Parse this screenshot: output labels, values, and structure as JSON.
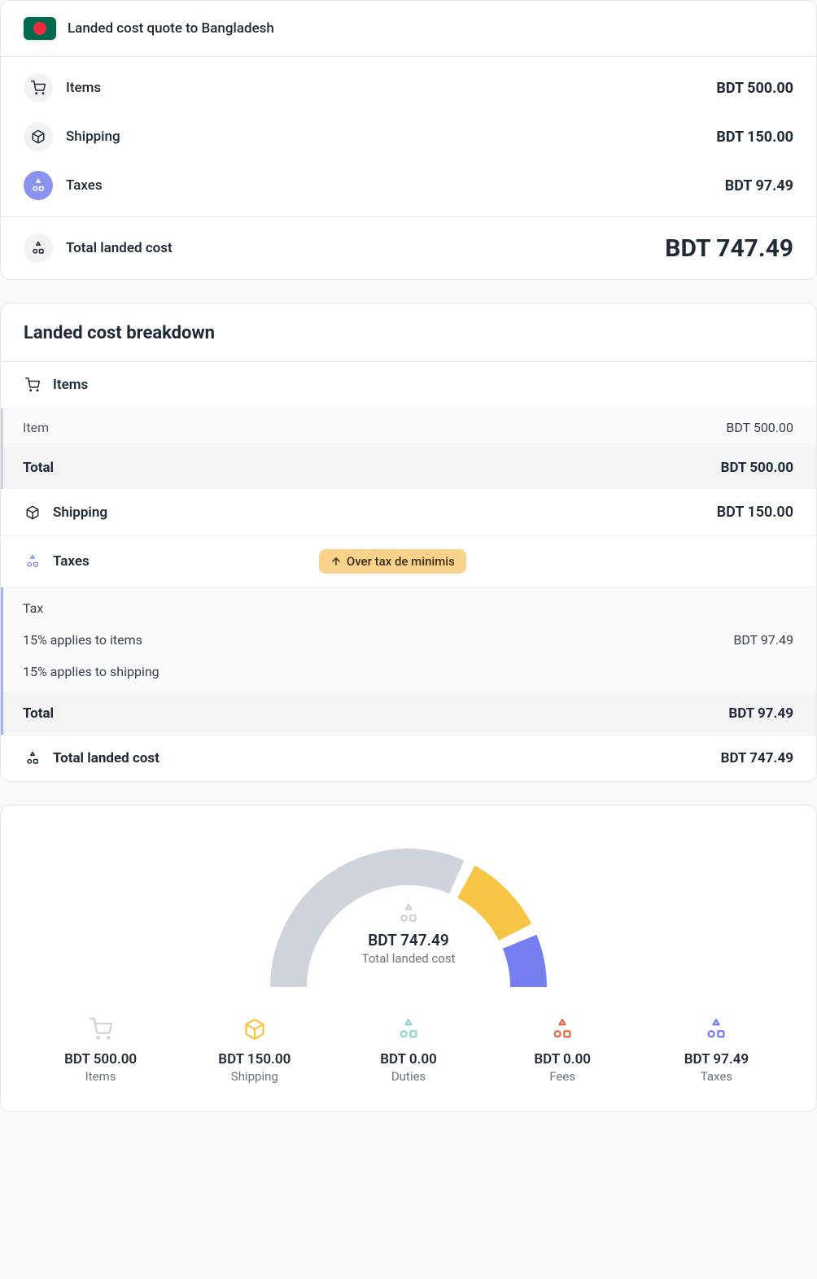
{
  "header": {
    "title": "Landed cost quote to Bangladesh"
  },
  "summary": {
    "items": {
      "label": "Items",
      "value": "BDT 500.00"
    },
    "shipping": {
      "label": "Shipping",
      "value": "BDT 150.00"
    },
    "taxes": {
      "label": "Taxes",
      "value": "BDT 97.49"
    },
    "total": {
      "label": "Total landed cost",
      "value": "BDT 747.49"
    }
  },
  "breakdown": {
    "title": "Landed cost breakdown",
    "items_header": "Items",
    "item_row": {
      "label": "Item",
      "value": "BDT 500.00"
    },
    "items_total": {
      "label": "Total",
      "value": "BDT 500.00"
    },
    "shipping": {
      "label": "Shipping",
      "value": "BDT 150.00"
    },
    "taxes_header": "Taxes",
    "taxes_pill": "Over tax de minimis",
    "tax_label": "Tax",
    "tax_line1": "15% applies to items",
    "tax_line1_value": "BDT 97.49",
    "tax_line2": "15% applies to shipping",
    "taxes_total": {
      "label": "Total",
      "value": "BDT 97.49"
    },
    "grand": {
      "label": "Total landed cost",
      "value": "BDT 747.49"
    }
  },
  "gauge": {
    "center_value": "BDT 747.49",
    "center_label": "Total landed cost",
    "stats": {
      "items": {
        "value": "BDT 500.00",
        "label": "Items"
      },
      "shipping": {
        "value": "BDT 150.00",
        "label": "Shipping"
      },
      "duties": {
        "value": "BDT 0.00",
        "label": "Duties"
      },
      "fees": {
        "value": "BDT 0.00",
        "label": "Fees"
      },
      "taxes": {
        "value": "BDT 97.49",
        "label": "Taxes"
      }
    }
  },
  "chart_data": {
    "type": "pie",
    "title": "Total landed cost",
    "total": 747.49,
    "currency": "BDT",
    "series": [
      {
        "name": "Items",
        "value": 500.0,
        "color": "#cfd3dc"
      },
      {
        "name": "Shipping",
        "value": 150.0,
        "color": "#f6c545"
      },
      {
        "name": "Duties",
        "value": 0.0,
        "color": "#5ec6c0"
      },
      {
        "name": "Fees",
        "value": 0.0,
        "color": "#e86b4a"
      },
      {
        "name": "Taxes",
        "value": 97.49,
        "color": "#757ff0"
      }
    ]
  }
}
